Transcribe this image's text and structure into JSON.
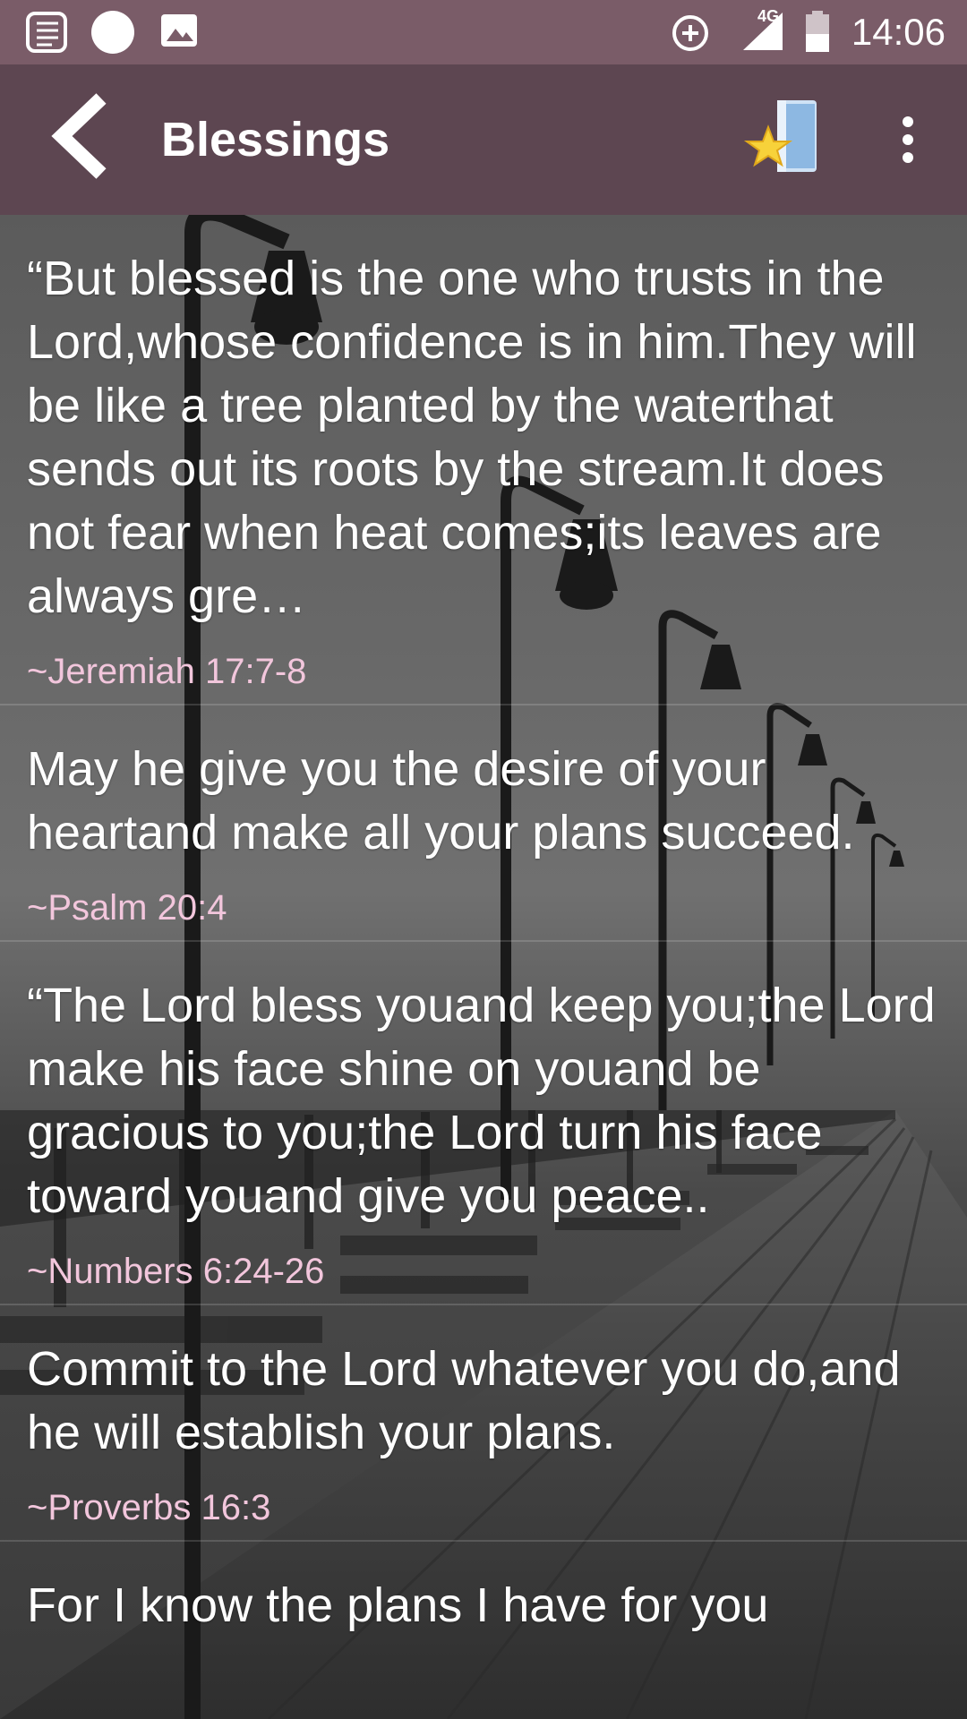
{
  "status_bar": {
    "network": "4G",
    "time": "14:06"
  },
  "app_bar": {
    "title": "Blessings"
  },
  "icons": {
    "back": "chevron-left-icon",
    "favorites": "star-book-icon",
    "more": "more-vertical-icon"
  },
  "colors": {
    "status_bar": "#7a5c68",
    "app_bar": "#5d4651",
    "reference_text": "#f2c6dc"
  },
  "verses": [
    {
      "text": "“But blessed is the one who trusts in the Lord,whose confidence is in him.They will be like a tree planted by the waterthat sends out its roots by the stream.It does not fear when heat comes;its leaves are always gre…",
      "reference": "~Jeremiah 17:7-8"
    },
    {
      "text": "May he give you the desire of your heartand make all your plans succeed.",
      "reference": "~Psalm 20:4"
    },
    {
      "text": "“The Lord bless youand keep you;the Lord make his face shine on youand be gracious to you;the Lord turn his face toward youand give you peace..",
      "reference": "~Numbers 6:24-26"
    },
    {
      "text": "Commit to the Lord whatever you do,and he will establish your plans.",
      "reference": "~Proverbs 16:3"
    },
    {
      "text": "For I know the plans I have for you",
      "reference": ""
    }
  ]
}
